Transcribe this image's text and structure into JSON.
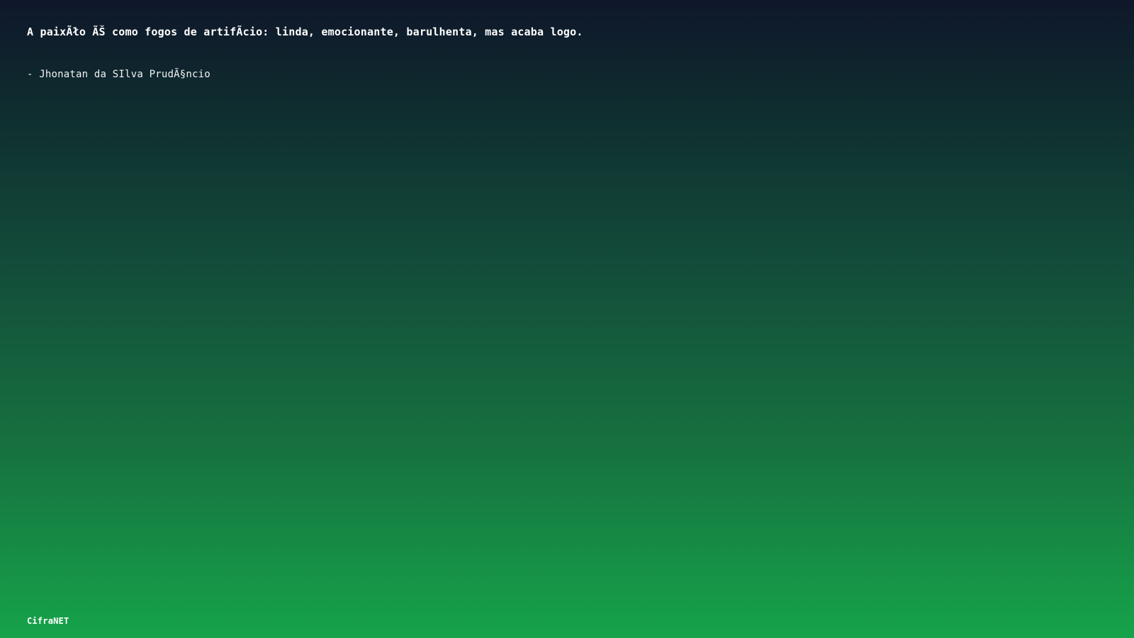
{
  "quote": {
    "text": "A paixÃło ÃŠ como fogos de artifÃ­cio: linda, emocionante, barulhenta, mas acaba logo.",
    "author": "- Jhonatan da SIlva PrudÃ§ncio"
  },
  "footer": {
    "brand": "CifraNET"
  },
  "colors": {
    "top": "#0f172a",
    "bottom": "#16a34a",
    "text": "#ffffff"
  }
}
